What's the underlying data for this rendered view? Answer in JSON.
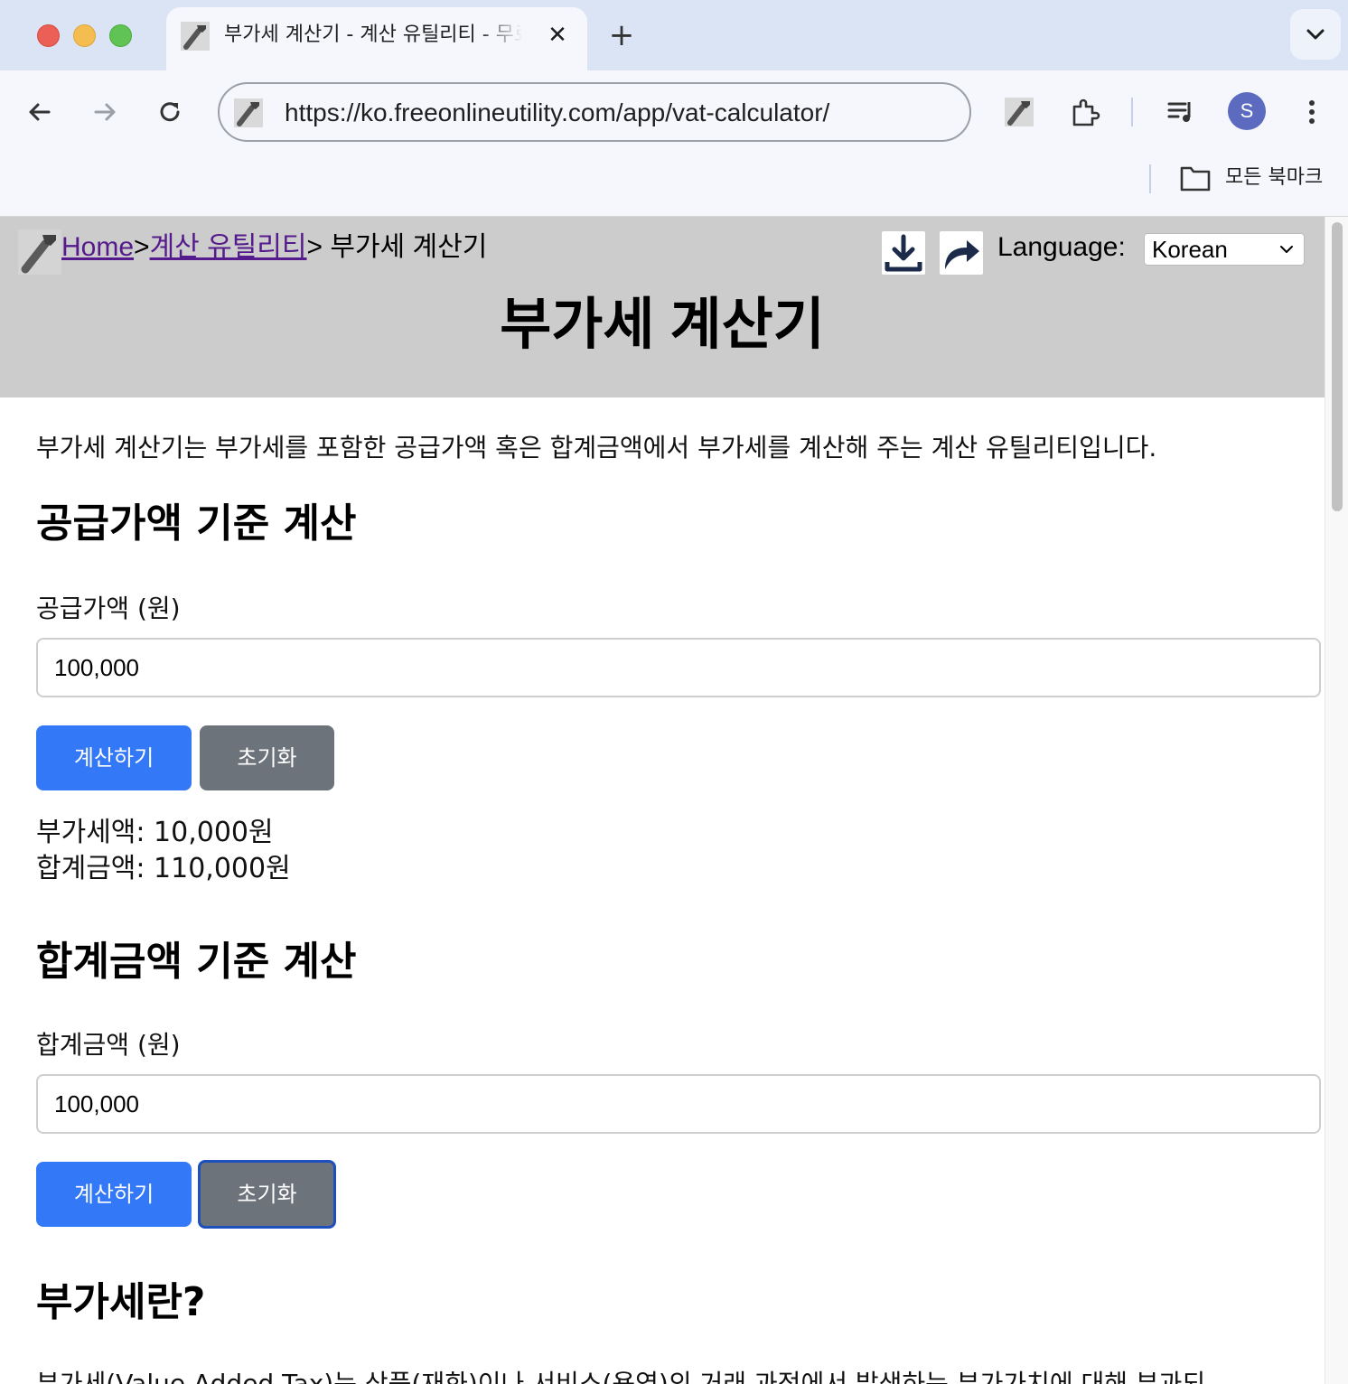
{
  "browser": {
    "tab_title": "부가세 계산기 - 계산 유틸리티 - 무료 온라인 유틸리티",
    "url": "https://ko.freeonlineutility.com/app/vat-calculator/",
    "profile_initial": "S",
    "bookmarks_label": "모든 북마크"
  },
  "header": {
    "breadcrumb": [
      {
        "label": "Home"
      },
      {
        "sep": ">"
      },
      {
        "label": "계산 유틸리티"
      },
      {
        "current": "> 부가세 계산기"
      }
    ],
    "language_label": "Language:",
    "language_value": "Korean",
    "title": "부가세 계산기"
  },
  "main": {
    "intro": "부가세 계산기는 부가세를 포함한 공급가액 혹은 합계금액에서 부가세를 계산해 주는 계산 유틸리티입니다.",
    "supply": {
      "heading": "공급가액 기준 계산",
      "label": "공급가액 (원)",
      "value": "100,000",
      "calc_label": "계산하기",
      "reset_label": "초기화",
      "result_vat": "부가세액: 10,000원",
      "result_total": "합계금액: 110,000원"
    },
    "total": {
      "heading": "합계금액 기준 계산",
      "label": "합계금액 (원)",
      "value": "100,000",
      "calc_label": "계산하기",
      "reset_label": "초기화"
    },
    "about": {
      "heading": "부가세란?",
      "paragraph": "부가세(Value Added Tax)는 상품(재화)이나 서비스(용역)의 거래 과정에서 발생하는 부가가치에 대해 부과되"
    }
  },
  "colors": {
    "primary_button": "#3378f6",
    "secondary_button": "#6c737b",
    "header_bg": "#cccccc",
    "visited_link": "#551a8b"
  }
}
